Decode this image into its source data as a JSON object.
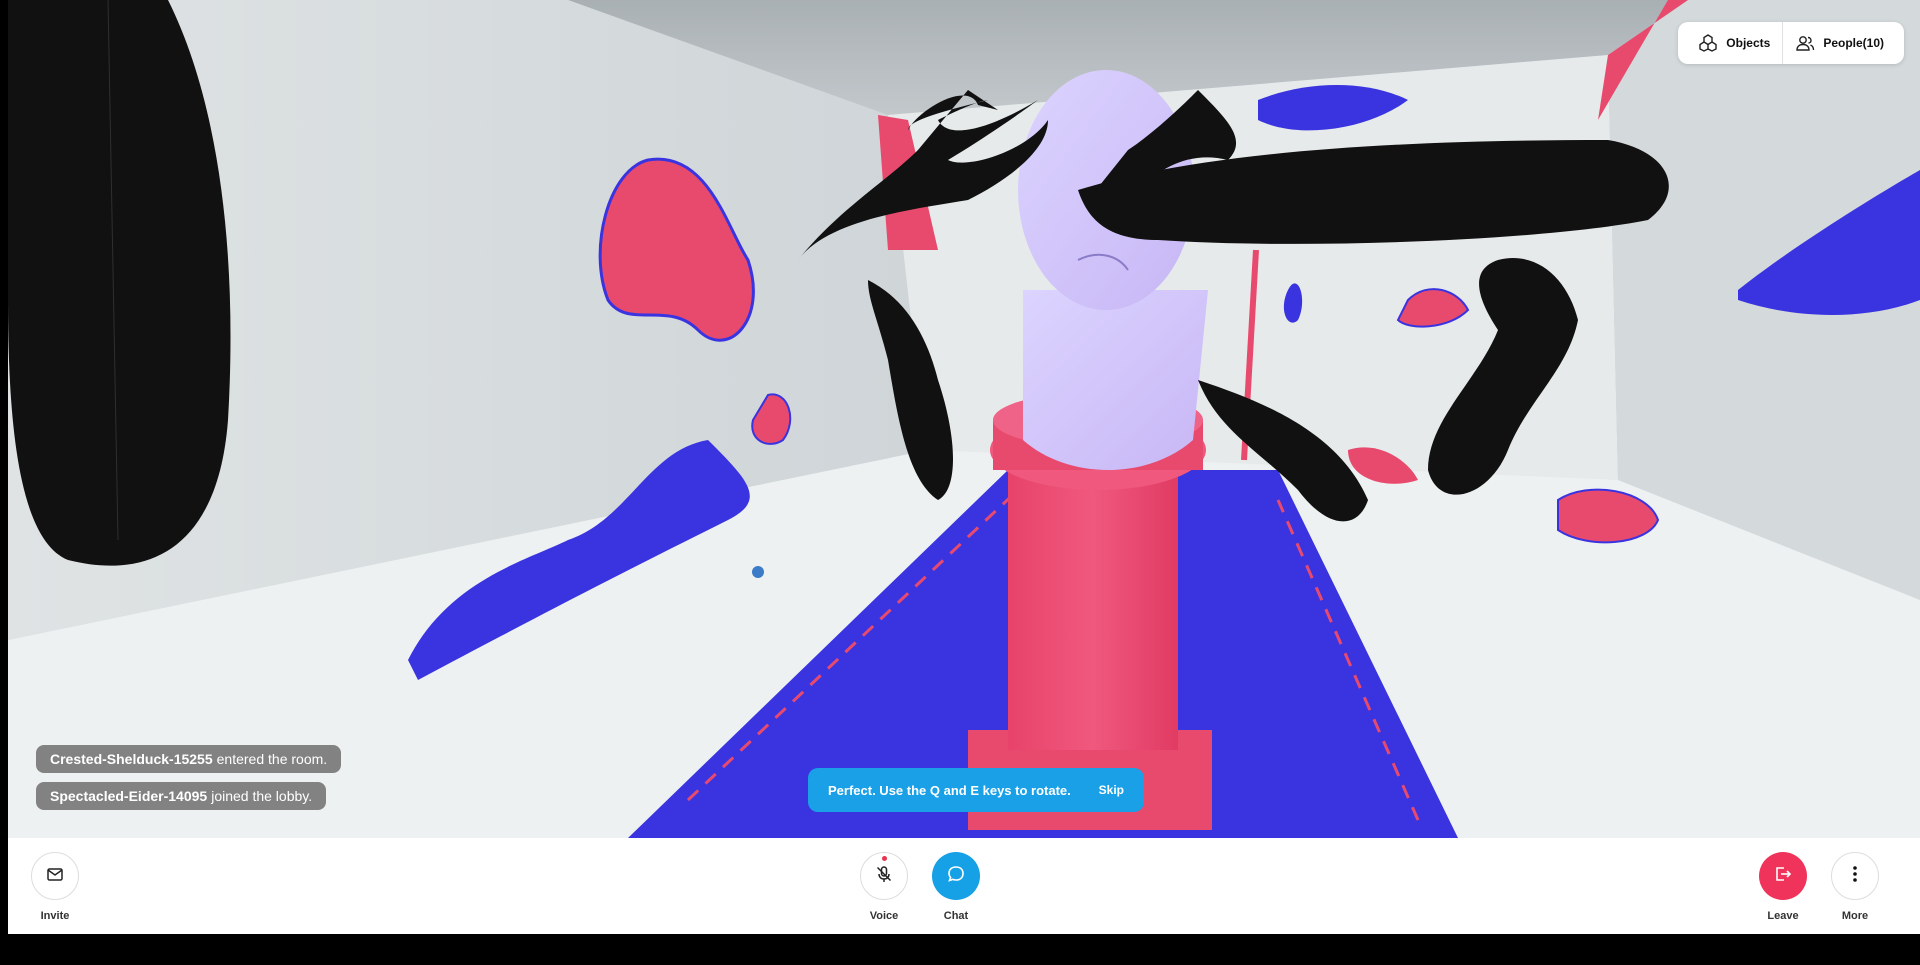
{
  "top_panel": {
    "objects_label": "Objects",
    "people_label": "People(10)"
  },
  "notifications": [
    {
      "name": "Crested-Shelduck-15255",
      "action": "entered the room."
    },
    {
      "name": "Spectacled-Eider-14095",
      "action": "joined the lobby."
    }
  ],
  "tip": {
    "text": "Perfect. Use the Q and E keys to rotate.",
    "skip_label": "Skip"
  },
  "toolbar": {
    "invite_label": "Invite",
    "voice_label": "Voice",
    "chat_label": "Chat",
    "leave_label": "Leave",
    "more_label": "More"
  },
  "colors": {
    "accent_blue": "#16a0e6",
    "leave_red": "#f0335a",
    "wall_blue": "#3a34e0",
    "wall_pink": "#e84a6e"
  },
  "icons": [
    "objects-icon",
    "people-icon",
    "mail-icon",
    "mic-muted-icon",
    "chat-bubble-icon",
    "leave-icon",
    "more-vertical-icon"
  ]
}
